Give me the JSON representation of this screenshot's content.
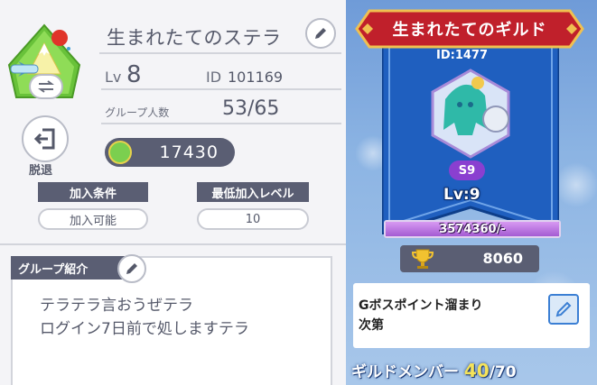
{
  "left_panel": {
    "group_name": "生まれたてのステラ",
    "level_label": "Lv",
    "level_value": "8",
    "id_label": "ID",
    "id_value": "101169",
    "members_label": "グループ人数",
    "members_value": "53/65",
    "leave_label": "脱退",
    "points_value": "17430",
    "join_condition_label": "加入条件",
    "join_condition_value": "加入可能",
    "min_level_label": "最低加入レベル",
    "min_level_value": "10",
    "intro_label": "グループ紹介",
    "intro_lines": [
      "テラテラ言おうぜテラ",
      "ログイン7日前で処しますテラ"
    ]
  },
  "right_panel": {
    "guild_name": "生まれたてのギルド",
    "guild_id": "ID:1477",
    "level_badge": "Lv:9",
    "level_number_badge": "S9",
    "exp_text": "3574360/-",
    "exp_fill_fraction": 1.0,
    "guild_points": "8060",
    "motto_lines": [
      "Gボスポイント溜まり",
      "次第"
    ],
    "member_label": "ギルドメンバー",
    "member_count": "40",
    "member_total": "/70"
  },
  "colors": {
    "dark_slate": "#5a5e73",
    "text_gray": "#55596a",
    "exp_purple": "#a45bd2",
    "banner_blue": "#1f5fbf",
    "title_red": "#c0202b",
    "member_yellow": "#f5e35a"
  },
  "icons": {
    "emblem": "mountain-airplane-emblem",
    "swap": "swap-arrows-icon",
    "edit": "pencil-icon",
    "leave": "exit-door-icon",
    "points": "medal-icon",
    "trophy": "trophy-icon"
  }
}
